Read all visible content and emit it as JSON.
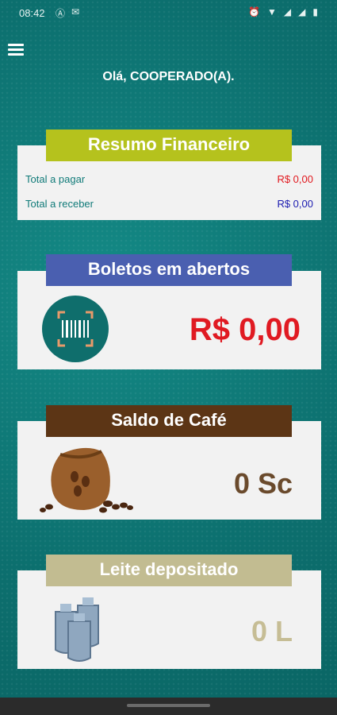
{
  "status": {
    "time": "08:42"
  },
  "header": {
    "greeting": "Olá, COOPERADO(A)."
  },
  "summary": {
    "title": "Resumo Financeiro",
    "pay_label": "Total a pagar",
    "pay_value": "R$ 0,00",
    "receive_label": "Total a receber",
    "receive_value": "R$ 0,00"
  },
  "bills": {
    "title": "Boletos em abertos",
    "value": "R$ 0,00"
  },
  "coffee": {
    "title": "Saldo de Café",
    "value": "0 Sc"
  },
  "milk": {
    "title": "Leite depositado",
    "value": "0 L"
  },
  "colors": {
    "background": "#0f7a78",
    "pay": "#e1181e",
    "receive": "#1a1ab0",
    "bills_tab": "#4a5fb0",
    "coffee_tab": "#5c3515",
    "milk_tab": "#c2bc91",
    "summary_tab": "#b5c21d"
  }
}
